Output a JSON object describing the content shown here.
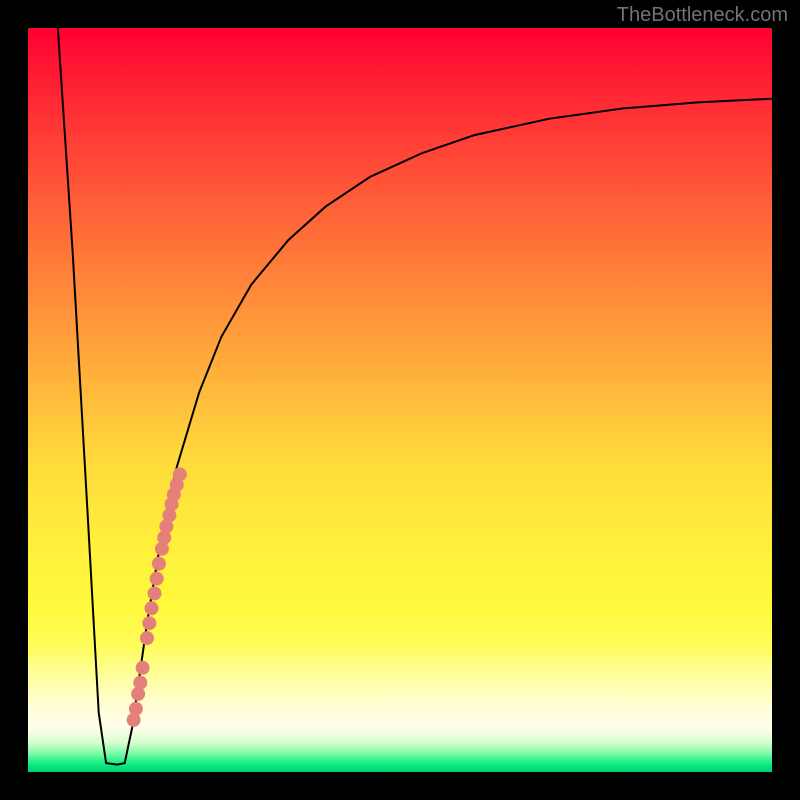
{
  "watermark": "TheBottleneck.com",
  "chart_data": {
    "type": "line",
    "title": "",
    "xlabel": "",
    "ylabel": "",
    "xlim": [
      0,
      100
    ],
    "ylim": [
      0,
      100
    ],
    "grid": false,
    "legend": false,
    "curve_description": "Black line: starts at top-left (x≈4,y≈100), plunges steeply to a flat minimum near x≈10–13 (y≈1), rises sharply then asymptotically toward y≈90 at x=100.",
    "curve_points_xy": [
      [
        4.0,
        100.0
      ],
      [
        6.0,
        70.0
      ],
      [
        8.0,
        35.0
      ],
      [
        9.5,
        8.0
      ],
      [
        10.5,
        1.2
      ],
      [
        12.0,
        1.0
      ],
      [
        13.0,
        1.2
      ],
      [
        14.0,
        6.0
      ],
      [
        16.0,
        20.0
      ],
      [
        18.0,
        32.0
      ],
      [
        20.0,
        41.0
      ],
      [
        23.0,
        51.0
      ],
      [
        26.0,
        58.5
      ],
      [
        30.0,
        65.5
      ],
      [
        35.0,
        71.5
      ],
      [
        40.0,
        76.0
      ],
      [
        46.0,
        80.0
      ],
      [
        53.0,
        83.2
      ],
      [
        60.0,
        85.6
      ],
      [
        70.0,
        87.8
      ],
      [
        80.0,
        89.2
      ],
      [
        90.0,
        90.0
      ],
      [
        100.0,
        90.5
      ]
    ],
    "points_xy": [
      [
        14.2,
        7.0
      ],
      [
        14.5,
        8.5
      ],
      [
        14.8,
        10.5
      ],
      [
        15.1,
        12.0
      ],
      [
        15.4,
        14.0
      ],
      [
        16.0,
        18.0
      ],
      [
        16.3,
        20.0
      ],
      [
        16.6,
        22.0
      ],
      [
        17.0,
        24.0
      ],
      [
        17.3,
        26.0
      ],
      [
        17.6,
        28.0
      ],
      [
        18.0,
        30.0
      ],
      [
        18.3,
        31.5
      ],
      [
        18.6,
        33.0
      ],
      [
        19.0,
        34.5
      ],
      [
        19.3,
        36.0
      ],
      [
        19.6,
        37.3
      ],
      [
        20.0,
        38.6
      ],
      [
        20.4,
        40.0
      ]
    ],
    "point_color": "#e57f7a",
    "curve_color": "#000000"
  }
}
